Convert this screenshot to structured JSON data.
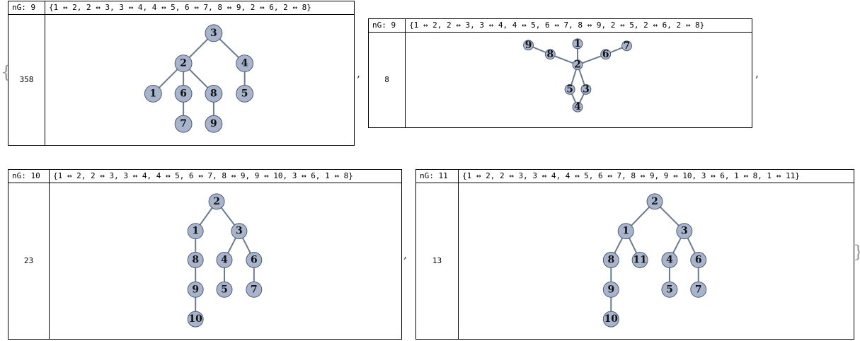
{
  "outer_open": "{",
  "outer_close": "}",
  "separator": ",",
  "panels": [
    {
      "header_left": "nG: 9",
      "edges_text": "{1 ↔ 2, 2 ↔ 3, 3 ↔ 4, 4 ↔ 5, 6 ↔ 7, 8 ↔ 9, 2 ↔ 6, 2 ↔ 8}",
      "count": "358",
      "edges": [
        [
          1,
          2
        ],
        [
          2,
          3
        ],
        [
          3,
          4
        ],
        [
          4,
          5
        ],
        [
          6,
          7
        ],
        [
          8,
          9
        ],
        [
          2,
          6
        ],
        [
          2,
          8
        ]
      ],
      "layout": "tree"
    },
    {
      "header_left": "nG: 9",
      "edges_text": "{1 ↔ 2, 2 ↔ 3, 3 ↔ 4, 4 ↔ 5, 6 ↔ 7, 8 ↔ 9, 2 ↔ 5, 2 ↔ 6, 2 ↔ 8}",
      "count": "8",
      "edges": [
        [
          1,
          2
        ],
        [
          2,
          3
        ],
        [
          3,
          4
        ],
        [
          4,
          5
        ],
        [
          6,
          7
        ],
        [
          8,
          9
        ],
        [
          2,
          5
        ],
        [
          2,
          6
        ],
        [
          2,
          8
        ]
      ],
      "layout": "spring"
    },
    {
      "header_left": "nG: 10",
      "edges_text": "{1 ↔ 2, 2 ↔ 3, 3 ↔ 4, 4 ↔ 5, 6 ↔ 7, 8 ↔ 9, 9 ↔ 10, 3 ↔ 6, 1 ↔ 8}",
      "count": "23",
      "edges": [
        [
          1,
          2
        ],
        [
          2,
          3
        ],
        [
          3,
          4
        ],
        [
          4,
          5
        ],
        [
          6,
          7
        ],
        [
          8,
          9
        ],
        [
          9,
          10
        ],
        [
          3,
          6
        ],
        [
          1,
          8
        ]
      ],
      "layout": "tree"
    },
    {
      "header_left": "nG: 11",
      "edges_text": "{1 ↔ 2, 2 ↔ 3, 3 ↔ 4, 4 ↔ 5, 6 ↔ 7, 8 ↔ 9, 9 ↔ 10, 3 ↔ 6, 1 ↔ 8, 1 ↔ 11}",
      "count": "13",
      "edges": [
        [
          1,
          2
        ],
        [
          2,
          3
        ],
        [
          3,
          4
        ],
        [
          4,
          5
        ],
        [
          6,
          7
        ],
        [
          8,
          9
        ],
        [
          9,
          10
        ],
        [
          3,
          6
        ],
        [
          1,
          8
        ],
        [
          1,
          11
        ]
      ],
      "layout": "tree"
    }
  ]
}
